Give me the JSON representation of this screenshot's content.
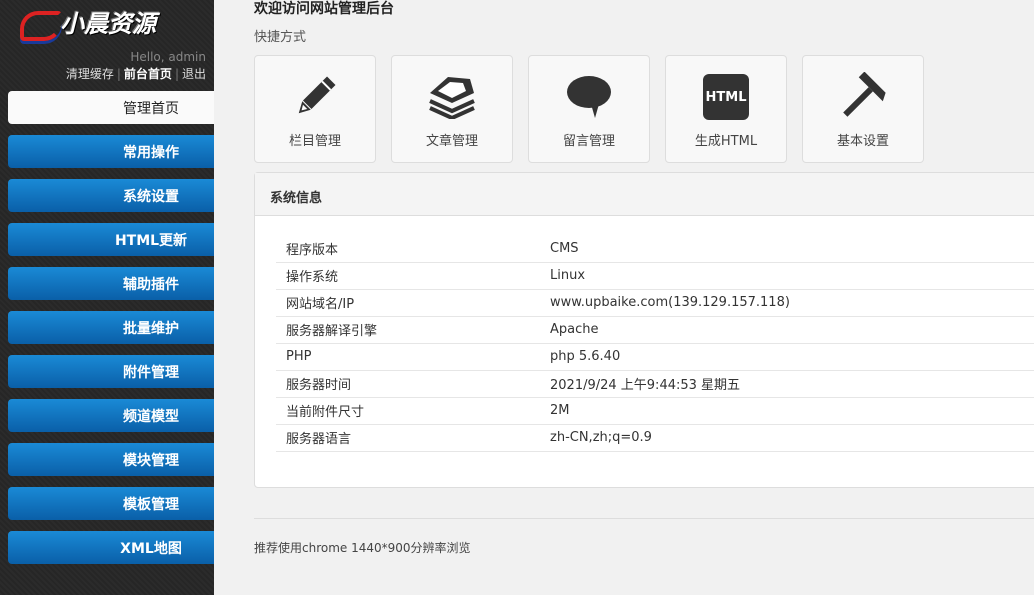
{
  "sidebar": {
    "logo": "小晨资源",
    "hello": "Hello, admin",
    "links": [
      "清理缓存",
      "前台首页",
      "退出"
    ],
    "items": [
      "管理首页",
      "常用操作",
      "系统设置",
      "HTML更新",
      "辅助插件",
      "批量维护",
      "附件管理",
      "频道模型",
      "模块管理",
      "模板管理",
      "XML地图"
    ]
  },
  "main": {
    "title": "欢迎访问网站管理后台",
    "quick_label": "快捷方式",
    "tiles": [
      {
        "label": "栏目管理",
        "icon": "pencil-icon"
      },
      {
        "label": "文章管理",
        "icon": "papers-icon"
      },
      {
        "label": "留言管理",
        "icon": "speech-bubble-icon"
      },
      {
        "label": "生成HTML",
        "icon": "html-icon",
        "icon_text": "HTML"
      },
      {
        "label": "基本设置",
        "icon": "hammer-icon"
      }
    ],
    "info": {
      "title": "系统信息",
      "rows": [
        [
          "程序版本",
          "CMS"
        ],
        [
          "操作系统",
          "Linux"
        ],
        [
          "网站域名/IP",
          "www.upbaike.com(139.129.157.118)"
        ],
        [
          "服务器解译引擎",
          "Apache"
        ],
        [
          "PHP",
          "php 5.6.40"
        ],
        [
          "服务器时间",
          "2021/9/24 上午9:44:53 星期五"
        ],
        [
          "当前附件尺寸",
          "2M"
        ],
        [
          "服务器语言",
          "zh-CN,zh;q=0.9"
        ]
      ]
    },
    "footer": "推荐使用chrome 1440*900分辨率浏览"
  }
}
